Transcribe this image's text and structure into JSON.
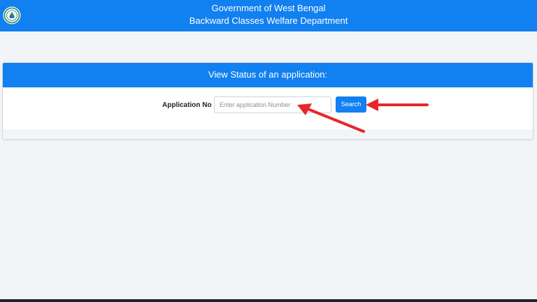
{
  "header": {
    "line1": "Government of West Bengal",
    "line2": "Backward Classes Welfare Department",
    "emblem_icon": "west-bengal-emblem-icon"
  },
  "status_card": {
    "title": "View Status of an application:",
    "application_label": "Application No :",
    "input_value": "",
    "input_placeholder": "Enter application Number",
    "search_label": "Search"
  },
  "colors": {
    "brand_blue": "#1180f0",
    "annotation_red": "#e8262a",
    "page_background": "#f3f4f7"
  }
}
